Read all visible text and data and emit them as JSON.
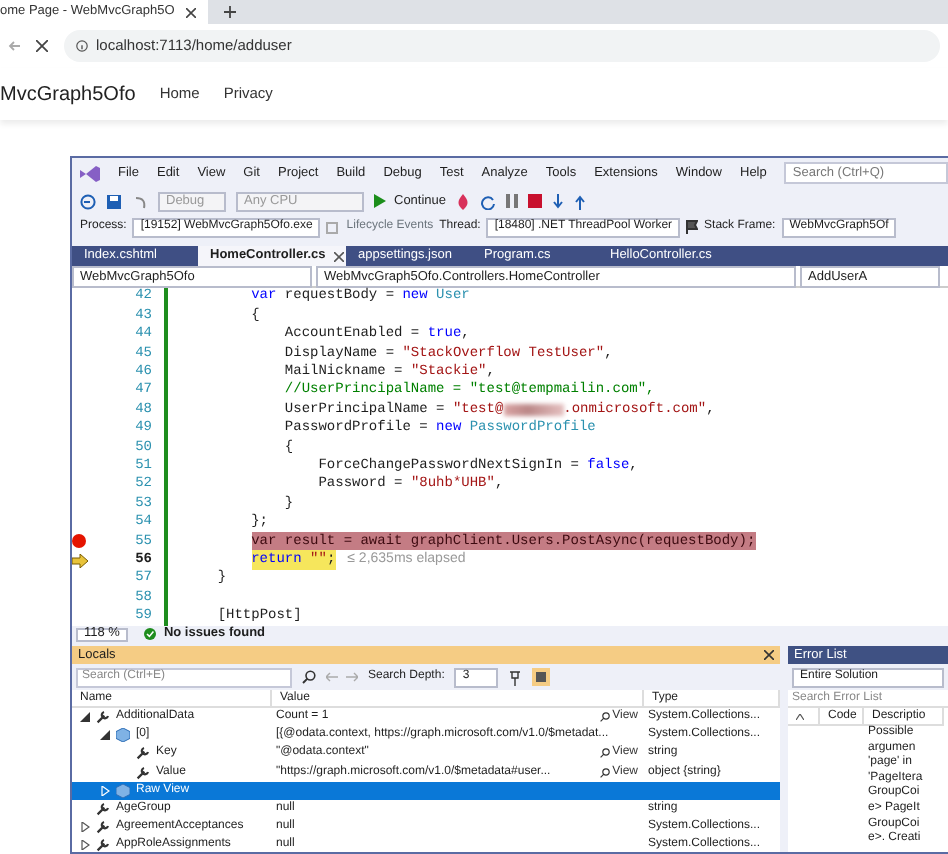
{
  "browser": {
    "tab_title": "ome Page - WebMvcGraph5O",
    "url": "localhost:7113/home/adduser"
  },
  "site_nav": {
    "brand": "MvcGraph5Ofo",
    "links": [
      "Home",
      "Privacy"
    ]
  },
  "ide": {
    "menu": [
      "File",
      "Edit",
      "View",
      "Git",
      "Project",
      "Build",
      "Debug",
      "Test",
      "Analyze",
      "Tools",
      "Extensions",
      "Window",
      "Help"
    ],
    "search": {
      "placeholder": "Search (Ctrl+Q)"
    },
    "toolbar": {
      "configuration": "Debug",
      "platform": "Any CPU",
      "continue": "Continue"
    },
    "debug_location": {
      "process_label": "Process:",
      "process": "[19152] WebMvcGraph5Ofo.exe",
      "lifecycle": "Lifecycle Events",
      "thread_label": "Thread:",
      "thread": "[18480] .NET ThreadPool Worker",
      "stack_frame_label": "Stack Frame:",
      "stack_frame": "WebMvcGraph5Of"
    },
    "tabs": [
      {
        "label": "Index.cshtml",
        "selected": false
      },
      {
        "label": "HomeController.cs",
        "selected": true
      },
      {
        "label": "appsettings.json",
        "selected": false
      },
      {
        "label": "Program.cs",
        "selected": false
      },
      {
        "label": "HelloController.cs",
        "selected": false
      }
    ],
    "navigation": [
      "WebMvcGraph5Ofo",
      "WebMvcGraph5Ofo.Controllers.HomeController",
      "AddUserA"
    ],
    "code": [
      {
        "number": "42",
        "breakpoint": false,
        "current": false,
        "tokens": [
          {
            "kind": "keyword",
            "text": "        var"
          },
          {
            "kind": "plain",
            "text": " requestBody = "
          },
          {
            "kind": "keyword",
            "text": "new"
          },
          {
            "kind": "type",
            "text": " User"
          }
        ]
      },
      {
        "number": "43",
        "breakpoint": false,
        "current": false,
        "tokens": [
          {
            "kind": "plain",
            "text": "        {"
          }
        ]
      },
      {
        "number": "44",
        "breakpoint": false,
        "current": false,
        "tokens": [
          {
            "kind": "plain",
            "text": "            AccountEnabled = "
          },
          {
            "kind": "keyword",
            "text": "true"
          },
          {
            "kind": "plain",
            "text": ","
          }
        ]
      },
      {
        "number": "45",
        "breakpoint": false,
        "current": false,
        "tokens": [
          {
            "kind": "plain",
            "text": "            DisplayName = "
          },
          {
            "kind": "string",
            "text": "\"StackOverflow TestUser\""
          },
          {
            "kind": "plain",
            "text": ","
          }
        ]
      },
      {
        "number": "46",
        "breakpoint": false,
        "current": false,
        "tokens": [
          {
            "kind": "plain",
            "text": "            MailNickname = "
          },
          {
            "kind": "string",
            "text": "\"Stackie\""
          },
          {
            "kind": "plain",
            "text": ","
          }
        ]
      },
      {
        "number": "47",
        "breakpoint": false,
        "current": false,
        "tokens": [
          {
            "kind": "comment",
            "text": "            //UserPrincipalName = \"test@tempmailin.com\","
          }
        ]
      },
      {
        "number": "48",
        "breakpoint": false,
        "current": false,
        "tokens": [
          {
            "kind": "plain",
            "text": "            UserPrincipalName = "
          },
          {
            "kind": "string",
            "text": "\"test@"
          },
          {
            "kind": "redacted"
          },
          {
            "kind": "string",
            "text": ".onmicrosoft.com\""
          },
          {
            "kind": "plain",
            "text": ","
          }
        ]
      },
      {
        "number": "49",
        "breakpoint": false,
        "current": false,
        "tokens": [
          {
            "kind": "plain",
            "text": "            PasswordProfile = "
          },
          {
            "kind": "keyword",
            "text": "new"
          },
          {
            "kind": "type",
            "text": " PasswordProfile"
          }
        ]
      },
      {
        "number": "50",
        "breakpoint": false,
        "current": false,
        "tokens": [
          {
            "kind": "plain",
            "text": "            {"
          }
        ]
      },
      {
        "number": "51",
        "breakpoint": false,
        "current": false,
        "tokens": [
          {
            "kind": "plain",
            "text": "                ForceChangePasswordNextSignIn = "
          },
          {
            "kind": "keyword",
            "text": "false"
          },
          {
            "kind": "plain",
            "text": ","
          }
        ]
      },
      {
        "number": "52",
        "breakpoint": false,
        "current": false,
        "tokens": [
          {
            "kind": "plain",
            "text": "                Password = "
          },
          {
            "kind": "string",
            "text": "\"8uhb*UHB\""
          },
          {
            "kind": "plain",
            "text": ","
          }
        ]
      },
      {
        "number": "53",
        "breakpoint": false,
        "current": false,
        "tokens": [
          {
            "kind": "plain",
            "text": "            }"
          }
        ]
      },
      {
        "number": "54",
        "breakpoint": false,
        "current": false,
        "tokens": [
          {
            "kind": "plain",
            "text": "        };"
          }
        ]
      },
      {
        "number": "55",
        "breakpoint": true,
        "current": false,
        "tokens": [
          {
            "kind": "plain",
            "text": "        var result = await graphClient.Users.PostAsync(requestBody);"
          }
        ]
      },
      {
        "number": "56",
        "breakpoint": false,
        "current": true,
        "tokens": [
          {
            "kind": "keyword",
            "text": "        return"
          },
          {
            "kind": "string",
            "text": " \"\""
          },
          {
            "kind": "plain",
            "text": ";"
          }
        ],
        "hint": "≤ 2,635ms elapsed"
      },
      {
        "number": "57",
        "breakpoint": false,
        "current": false,
        "tokens": [
          {
            "kind": "plain",
            "text": "    }"
          }
        ]
      },
      {
        "number": "58",
        "breakpoint": false,
        "current": false
      },
      {
        "number": "59",
        "breakpoint": false,
        "current": false,
        "tokens": [
          {
            "kind": "plain",
            "text": "    [HttpPost]"
          }
        ]
      }
    ],
    "status": {
      "zoom": "118 %",
      "issues": "No issues found"
    }
  },
  "locals": {
    "title": "Locals",
    "search": {
      "placeholder": "Search (Ctrl+E)"
    },
    "depth_label": "Search Depth:",
    "depth": "3",
    "columns": [
      "Name",
      "Value",
      "Type"
    ],
    "rows": [
      {
        "name": "AdditionalData",
        "kind": "property",
        "expanded": true,
        "selected": false,
        "value": "Count = 1",
        "view": "View",
        "type": "System.Collections...",
        "children": [
          {
            "name": "[0]",
            "kind": "object",
            "expanded": true,
            "selected": false,
            "value": "[{@odata.context, https://graph.microsoft.com/v1.0/$metadat...",
            "type": "System.Collections...",
            "children": [
              {
                "name": "Key",
                "kind": "property",
                "selected": false,
                "value": "\"@odata.context\"",
                "view": "View",
                "type": "string"
              },
              {
                "name": "Value",
                "kind": "property",
                "selected": false,
                "value": "\"https://graph.microsoft.com/v1.0/$metadata#user...",
                "view": "View",
                "type": "object {string}"
              }
            ]
          },
          {
            "name": "Raw View",
            "kind": "object",
            "expanded": false,
            "selected": true
          }
        ]
      },
      {
        "name": "AgeGroup",
        "kind": "property",
        "selected": false,
        "value": "null",
        "type": "string"
      },
      {
        "name": "AgreementAcceptances",
        "kind": "property",
        "expanded": false,
        "selected": false,
        "value": "null",
        "type": "System.Collections..."
      },
      {
        "name": "AppRoleAssignments",
        "kind": "property",
        "expanded": false,
        "selected": false,
        "value": "null",
        "type": "System.Collections..."
      }
    ]
  },
  "error_list": {
    "title": "Error List",
    "scope": "Entire Solution",
    "search": {
      "placeholder": "Search Error List"
    },
    "columns": [
      "Code",
      "Descriptio"
    ],
    "description_lines": [
      "Possible",
      "argumen",
      "'page' in",
      "'PageItera",
      "GroupCoi",
      "e> PageIt",
      "GroupCoi",
      "e>. Creati"
    ]
  }
}
